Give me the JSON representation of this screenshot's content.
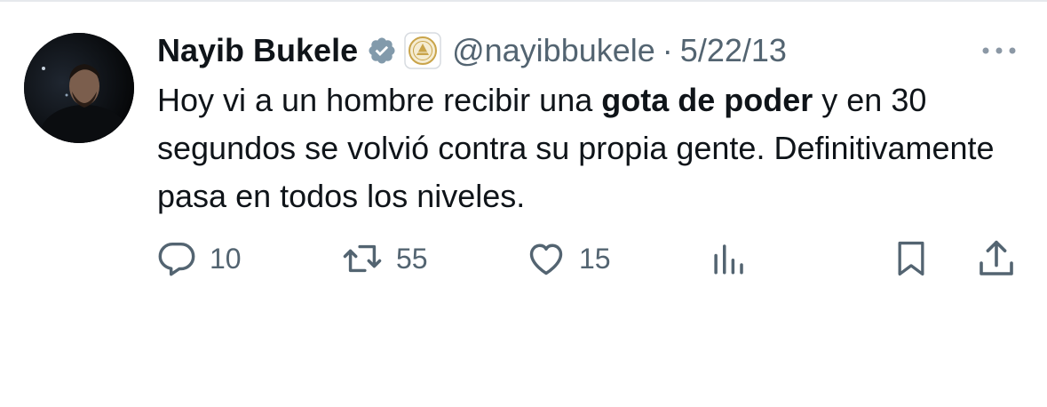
{
  "tweet": {
    "author_name": "Nayib Bukele",
    "handle": "@nayibbukele",
    "separator": "·",
    "date": "5/22/13",
    "text_part1": "Hoy vi a un hombre recibir una ",
    "text_bold": "gota de poder",
    "text_part2": " y en 30 segundos se volvió contra su propia gente. Definitivamente pasa en todos los niveles."
  },
  "actions": {
    "replies": "10",
    "retweets": "55",
    "likes": "15"
  },
  "icons": {
    "verified": "verified-badge-icon",
    "affiliate": "el-salvador-seal-icon",
    "more": "more-options-icon",
    "reply": "reply-icon",
    "retweet": "retweet-icon",
    "like": "heart-icon",
    "views": "analytics-icon",
    "bookmark": "bookmark-icon",
    "share": "share-icon"
  },
  "colors": {
    "text": "#0f1419",
    "secondary": "#536471",
    "verified_badge": "#829aab",
    "seal_gold": "#c9a44a"
  }
}
